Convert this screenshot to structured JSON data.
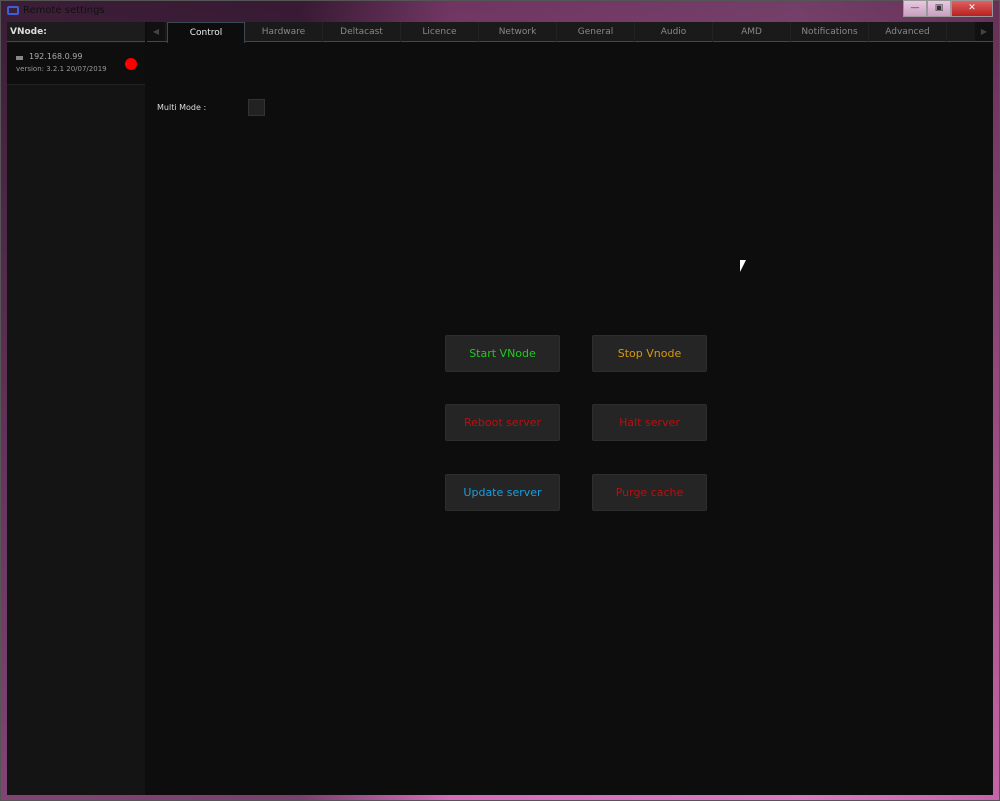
{
  "window": {
    "title": "Remote settings",
    "controls": [
      "minimize",
      "maximize",
      "close"
    ]
  },
  "sidebar": {
    "header": "VNode:",
    "nodes": [
      {
        "ip": "192.168.0.99",
        "version": "version: 3.2.1 20/07/2019",
        "status_color": "#ff0000"
      }
    ]
  },
  "tabs": [
    {
      "label": "Control",
      "active": true
    },
    {
      "label": "Hardware"
    },
    {
      "label": "Deltacast"
    },
    {
      "label": "Licence"
    },
    {
      "label": "Network"
    },
    {
      "label": "General"
    },
    {
      "label": "Audio"
    },
    {
      "label": "AMD"
    },
    {
      "label": "Notifications"
    },
    {
      "label": "Advanced"
    }
  ],
  "control": {
    "multi_mode_label": "Multi Mode :",
    "multi_mode_checked": false,
    "buttons": [
      {
        "label": "Start VNode",
        "color": "#1ecb1e"
      },
      {
        "label": "Stop Vnode",
        "color": "#d99a0a"
      },
      {
        "label": "Reboot server",
        "color": "#b81010"
      },
      {
        "label": "Halt server",
        "color": "#b81010"
      },
      {
        "label": "Update server",
        "color": "#1a9ee0"
      },
      {
        "label": "Purge cache",
        "color": "#b81010"
      }
    ]
  }
}
